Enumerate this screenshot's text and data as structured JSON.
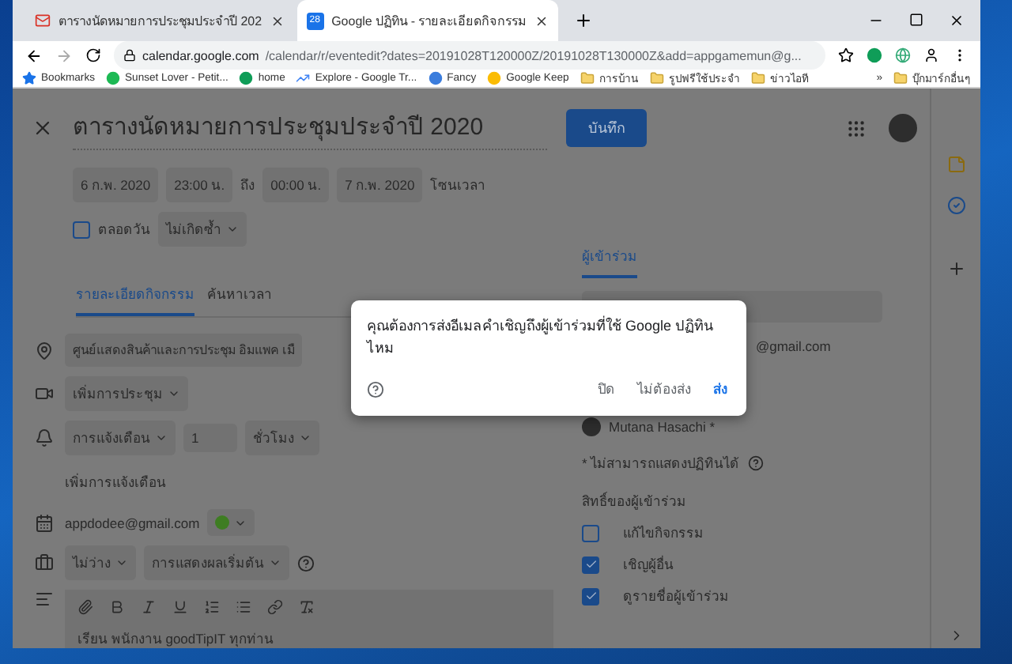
{
  "browser": {
    "tabs": [
      {
        "title": "ตารางนัดหมายการประชุมประจำปี 202",
        "kind": "mail",
        "selected": false
      },
      {
        "title": "Google ปฏิทิน - รายละเอียดกิจกรรม",
        "kind": "calendar",
        "icon_text": "28",
        "selected": true
      }
    ],
    "url_host": "calendar.google.com",
    "url_path": "/calendar/r/eventedit?dates=20191028T120000Z/20191028T130000Z&add=appgamemun@g...",
    "bookmarks": [
      {
        "label": "Bookmarks",
        "kind": "star",
        "color": "#1a73e8"
      },
      {
        "label": "Sunset Lover - Petit...",
        "kind": "site",
        "color": "#1db954"
      },
      {
        "label": "home",
        "kind": "site",
        "color": "#0f9d58"
      },
      {
        "label": "Explore - Google Tr...",
        "kind": "trend",
        "color": "#4285f4"
      },
      {
        "label": "Fancy",
        "kind": "site",
        "color": "#3b7ddd"
      },
      {
        "label": "Google Keep",
        "kind": "site",
        "color": "#fbbc04"
      },
      {
        "label": "การบ้าน",
        "kind": "folder",
        "color": "#f6d36b"
      },
      {
        "label": "รูปฟรีใช้ประจำ",
        "kind": "folder",
        "color": "#f6d36b"
      },
      {
        "label": "ข่าวไอที",
        "kind": "folder",
        "color": "#f6d36b"
      }
    ],
    "more": "»",
    "other_bookmarks": "บุ๊กมาร์กอื่นๆ"
  },
  "event": {
    "title": "ตารางนัดหมายการประชุมประจำปี 2020",
    "save": "บันทึก",
    "start_date": "6 ก.พ. 2020",
    "start_time": "23:00 น.",
    "to": "ถึง",
    "end_time": "00:00 น.",
    "end_date": "7 ก.พ. 2020",
    "timezone": "โซนเวลา",
    "all_day": {
      "label": "ตลอดวัน",
      "checked": false
    },
    "repeat": "ไม่เกิดซ้ำ",
    "tabs": [
      {
        "label": "รายละเอียดกิจกรรม",
        "selected": true
      },
      {
        "label": "ค้นหาเวลา",
        "selected": false
      }
    ],
    "location": "ศูนย์แสดงสินค้าและการประชุม อิมแพค เมื",
    "conference": "เพิ่มการประชุม",
    "notification": {
      "type": "การแจ้งเตือน",
      "amount": "1",
      "unit": "ชั่วโมง"
    },
    "add_notification": "เพิ่มการแจ้งเตือน",
    "calendar": {
      "owner": "appdodee@gmail.com",
      "color": "#3e7d22"
    },
    "busy": "ไม่ว่าง",
    "visibility": "การแสดงผลเริ่มต้น",
    "description": "เรียน พนักงาน goodTipIT ทุกท่าน"
  },
  "guests": {
    "tab": "ผู้เข้าร่วม",
    "list": [
      {
        "name": "@gmail.com",
        "kind": "email"
      },
      {
        "name": "Mutana Hasachi *",
        "kind": "person"
      }
    ],
    "note": "* ไม่สามารถแสดงปฏิทินได้",
    "permissions_title": "สิทธิ์ของผู้เข้าร่วม",
    "permissions": [
      {
        "label": "แก้ไขกิจกรรม",
        "checked": false
      },
      {
        "label": "เชิญผู้อื่น",
        "checked": true
      },
      {
        "label": "ดูรายชื่อผู้เข้าร่วม",
        "checked": true
      }
    ]
  },
  "dialog": {
    "message": "คุณต้องการส่งอีเมลคำเชิญถึงผู้เข้าร่วมที่ใช้ Google ปฏิทินไหม",
    "buttons": [
      {
        "label": "ปิด",
        "kind": "plain"
      },
      {
        "label": "ไม่ต้องส่ง",
        "kind": "plain"
      },
      {
        "label": "ส่ง",
        "kind": "primary"
      }
    ]
  }
}
